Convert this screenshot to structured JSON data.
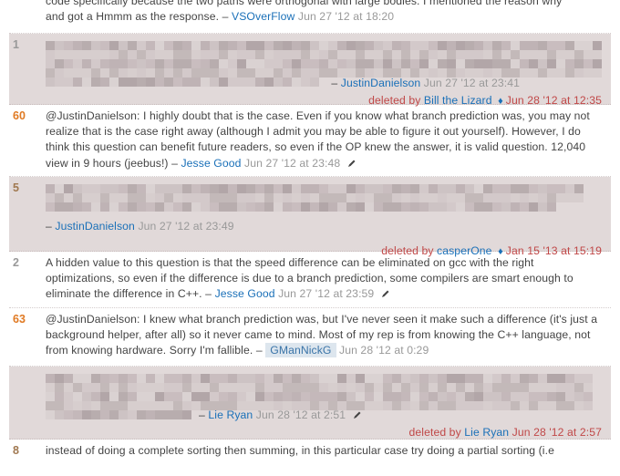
{
  "comments": [
    {
      "score": "",
      "text_lines": [
        "code specifically because the two paths were orthogonal with large bodies. I mentioned the reason why",
        "and got a Hmmm as the response."
      ],
      "user": "VSOverFlow",
      "date": "Jun 27 '12 at 18:20",
      "deleted": false
    },
    {
      "score": "1",
      "text": "[redacted deleted comment]",
      "user": "JustinDanielson",
      "date": "Jun 27 '12 at 23:41",
      "deleted": true,
      "deleted_by_label": "deleted by",
      "deleted_by": "Bill the Lizard",
      "deleted_by_moderator": true,
      "deleted_date": "Jun 28 '12 at 12:35"
    },
    {
      "score": "60",
      "text": "@JustinDanielson: I highly doubt that is the case. Even if you know what branch prediction was, you may not realize that is the case right away (although I admit you may be able to figure it out yourself). However, I do think this question can benefit future readers, so even if the OP knew the answer, it is valid question. 12,040 view in 9 hours (jeebus!)",
      "user": "Jesse Good",
      "date": "Jun 27 '12 at 23:48",
      "edited": true,
      "deleted": false
    },
    {
      "score": "5",
      "text": "[redacted deleted comment]",
      "user": "JustinDanielson",
      "date": "Jun 27 '12 at 23:49",
      "deleted": true,
      "deleted_by_label": "deleted by",
      "deleted_by": "casperOne",
      "deleted_by_moderator": true,
      "deleted_date": "Jan 15 '13 at 15:19"
    },
    {
      "score": "2",
      "text": "A hidden value to this question is that the speed difference can be eliminated on gcc with the right optimizations, so even if the difference is due to a branch prediction, some compilers are smart enough to eliminate the difference in C++.",
      "user": "Jesse Good",
      "date": "Jun 27 '12 at 23:59",
      "edited": true,
      "deleted": false
    },
    {
      "score": "63",
      "text": "@JustinDanielson: I knew what branch prediction was, but I've never seen it make such a difference (it's just a background helper, after all) so it never came to mind. Most of my rep is from knowing the C++ language, not from knowing hardware. Sorry I'm fallible.",
      "user": "GManNickG",
      "user_is_op": true,
      "date": "Jun 28 '12 at 0:29",
      "deleted": false
    },
    {
      "score": "",
      "text": "[redacted deleted comment]",
      "user": "Lie Ryan",
      "date": "Jun 28 '12 at 2:51",
      "edited": true,
      "deleted": true,
      "deleted_by_label": "deleted by",
      "deleted_by": "Lie Ryan",
      "deleted_by_moderator": false,
      "deleted_date": "Jun 28 '12 at 2:57"
    },
    {
      "score": "8",
      "text": "instead of doing a complete sorting then summing, in this particular case try doing a partial sorting (i.e",
      "deleted": false
    }
  ],
  "separator": "–"
}
